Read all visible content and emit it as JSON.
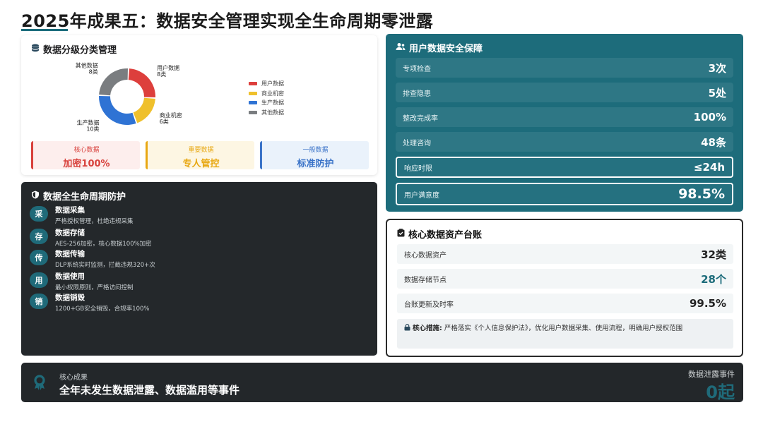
{
  "title": "2025年成果五：数据安全管理实现全生命周期零泄露",
  "classification": {
    "heading": "数据分级分类管理",
    "tiers": [
      {
        "label": "核心数据",
        "value": "加密100%",
        "color": "#d8413c",
        "bg": "#fdeeed"
      },
      {
        "label": "重要数据",
        "value": "专人管控",
        "color": "#e8a812",
        "bg": "#fdf6e3"
      },
      {
        "label": "一般数据",
        "value": "标准防护",
        "color": "#3a73c8",
        "bg": "#eaf2fb"
      }
    ]
  },
  "chart_data": {
    "type": "pie",
    "variant": "donut",
    "unit": "类",
    "categories": [
      "用户数据",
      "商业机密",
      "生产数据",
      "其他数据"
    ],
    "values": [
      8,
      6,
      10,
      8
    ],
    "colors": [
      "#dd3f3c",
      "#efc02c",
      "#2f73d4",
      "#7a7d80"
    ],
    "slice_labels": [
      {
        "name": "用户数据",
        "value": "8类"
      },
      {
        "name": "商业机密",
        "value": "6类"
      },
      {
        "name": "生产数据",
        "value": "10类"
      },
      {
        "name": "其他数据",
        "value": "8类"
      }
    ],
    "legend": [
      "用户数据",
      "商业机密",
      "生产数据",
      "其他数据"
    ],
    "legend_position": "right"
  },
  "lifecycle": {
    "heading": "数据全生命周期防护",
    "stages": [
      {
        "badge": "采",
        "title": "数据采集",
        "desc": "严格授权管理，杜绝违规采集"
      },
      {
        "badge": "存",
        "title": "数据存储",
        "desc": "AES-256加密，核心数据100%加密"
      },
      {
        "badge": "传",
        "title": "数据传输",
        "desc": "DLP系统实时监测，拦截违规320+次"
      },
      {
        "badge": "用",
        "title": "数据使用",
        "desc": "最小权限原则，严格访问控制"
      },
      {
        "badge": "销",
        "title": "数据销毁",
        "desc": "1200+GB安全销毁，合规率100%"
      }
    ]
  },
  "user_security": {
    "heading": "用户数据安全保障",
    "rows": [
      {
        "label": "专项检查",
        "value": "3次"
      },
      {
        "label": "排查隐患",
        "value": "5处"
      },
      {
        "label": "整改完成率",
        "value": "100%"
      },
      {
        "label": "处理咨询",
        "value": "48条"
      },
      {
        "label": "响应时限",
        "value": "≤24h"
      },
      {
        "label": "用户满意度",
        "value": "98.5%"
      }
    ]
  },
  "ledger": {
    "heading": "核心数据资产台账",
    "rows": [
      {
        "label": "核心数据资产",
        "value": "32类"
      },
      {
        "label": "数据存储节点",
        "value": "28个"
      },
      {
        "label": "台账更新及时率",
        "value": "99.5%"
      }
    ],
    "note_key": "核心措施:",
    "note_text": "严格落实《个人信息保护法》，优化用户数据采集、使用流程，明确用户授权范围"
  },
  "bottom": {
    "label": "核心成果",
    "text": "全年未发生数据泄露、数据滥用等事件",
    "right_label": "数据泄露事件",
    "right_value": "0起"
  },
  "colors": {
    "teal": "#1d6c7b",
    "dark": "#24282b"
  },
  "icons": {
    "classification": "database-icon",
    "user_security": "users-icon",
    "lifecycle": "shield-icon",
    "ledger": "clipboard-icon",
    "note": "lock-icon",
    "bottom": "award-icon"
  }
}
